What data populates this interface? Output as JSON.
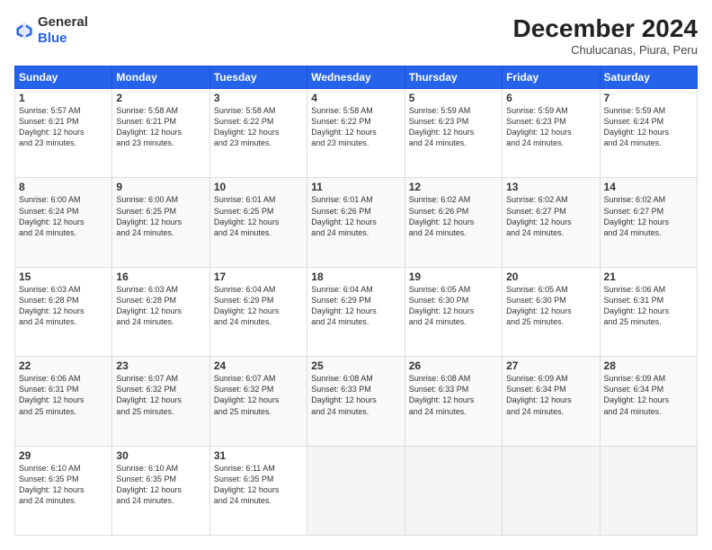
{
  "header": {
    "logo_general": "General",
    "logo_blue": "Blue",
    "month_title": "December 2024",
    "subtitle": "Chulucanas, Piura, Peru"
  },
  "weekdays": [
    "Sunday",
    "Monday",
    "Tuesday",
    "Wednesday",
    "Thursday",
    "Friday",
    "Saturday"
  ],
  "weeks": [
    [
      {
        "day": "1",
        "lines": [
          "Sunrise: 5:57 AM",
          "Sunset: 6:21 PM",
          "Daylight: 12 hours",
          "and 23 minutes."
        ]
      },
      {
        "day": "2",
        "lines": [
          "Sunrise: 5:58 AM",
          "Sunset: 6:21 PM",
          "Daylight: 12 hours",
          "and 23 minutes."
        ]
      },
      {
        "day": "3",
        "lines": [
          "Sunrise: 5:58 AM",
          "Sunset: 6:22 PM",
          "Daylight: 12 hours",
          "and 23 minutes."
        ]
      },
      {
        "day": "4",
        "lines": [
          "Sunrise: 5:58 AM",
          "Sunset: 6:22 PM",
          "Daylight: 12 hours",
          "and 23 minutes."
        ]
      },
      {
        "day": "5",
        "lines": [
          "Sunrise: 5:59 AM",
          "Sunset: 6:23 PM",
          "Daylight: 12 hours",
          "and 24 minutes."
        ]
      },
      {
        "day": "6",
        "lines": [
          "Sunrise: 5:59 AM",
          "Sunset: 6:23 PM",
          "Daylight: 12 hours",
          "and 24 minutes."
        ]
      },
      {
        "day": "7",
        "lines": [
          "Sunrise: 5:59 AM",
          "Sunset: 6:24 PM",
          "Daylight: 12 hours",
          "and 24 minutes."
        ]
      }
    ],
    [
      {
        "day": "8",
        "lines": [
          "Sunrise: 6:00 AM",
          "Sunset: 6:24 PM",
          "Daylight: 12 hours",
          "and 24 minutes."
        ]
      },
      {
        "day": "9",
        "lines": [
          "Sunrise: 6:00 AM",
          "Sunset: 6:25 PM",
          "Daylight: 12 hours",
          "and 24 minutes."
        ]
      },
      {
        "day": "10",
        "lines": [
          "Sunrise: 6:01 AM",
          "Sunset: 6:25 PM",
          "Daylight: 12 hours",
          "and 24 minutes."
        ]
      },
      {
        "day": "11",
        "lines": [
          "Sunrise: 6:01 AM",
          "Sunset: 6:26 PM",
          "Daylight: 12 hours",
          "and 24 minutes."
        ]
      },
      {
        "day": "12",
        "lines": [
          "Sunrise: 6:02 AM",
          "Sunset: 6:26 PM",
          "Daylight: 12 hours",
          "and 24 minutes."
        ]
      },
      {
        "day": "13",
        "lines": [
          "Sunrise: 6:02 AM",
          "Sunset: 6:27 PM",
          "Daylight: 12 hours",
          "and 24 minutes."
        ]
      },
      {
        "day": "14",
        "lines": [
          "Sunrise: 6:02 AM",
          "Sunset: 6:27 PM",
          "Daylight: 12 hours",
          "and 24 minutes."
        ]
      }
    ],
    [
      {
        "day": "15",
        "lines": [
          "Sunrise: 6:03 AM",
          "Sunset: 6:28 PM",
          "Daylight: 12 hours",
          "and 24 minutes."
        ]
      },
      {
        "day": "16",
        "lines": [
          "Sunrise: 6:03 AM",
          "Sunset: 6:28 PM",
          "Daylight: 12 hours",
          "and 24 minutes."
        ]
      },
      {
        "day": "17",
        "lines": [
          "Sunrise: 6:04 AM",
          "Sunset: 6:29 PM",
          "Daylight: 12 hours",
          "and 24 minutes."
        ]
      },
      {
        "day": "18",
        "lines": [
          "Sunrise: 6:04 AM",
          "Sunset: 6:29 PM",
          "Daylight: 12 hours",
          "and 24 minutes."
        ]
      },
      {
        "day": "19",
        "lines": [
          "Sunrise: 6:05 AM",
          "Sunset: 6:30 PM",
          "Daylight: 12 hours",
          "and 24 minutes."
        ]
      },
      {
        "day": "20",
        "lines": [
          "Sunrise: 6:05 AM",
          "Sunset: 6:30 PM",
          "Daylight: 12 hours",
          "and 25 minutes."
        ]
      },
      {
        "day": "21",
        "lines": [
          "Sunrise: 6:06 AM",
          "Sunset: 6:31 PM",
          "Daylight: 12 hours",
          "and 25 minutes."
        ]
      }
    ],
    [
      {
        "day": "22",
        "lines": [
          "Sunrise: 6:06 AM",
          "Sunset: 6:31 PM",
          "Daylight: 12 hours",
          "and 25 minutes."
        ]
      },
      {
        "day": "23",
        "lines": [
          "Sunrise: 6:07 AM",
          "Sunset: 6:32 PM",
          "Daylight: 12 hours",
          "and 25 minutes."
        ]
      },
      {
        "day": "24",
        "lines": [
          "Sunrise: 6:07 AM",
          "Sunset: 6:32 PM",
          "Daylight: 12 hours",
          "and 25 minutes."
        ]
      },
      {
        "day": "25",
        "lines": [
          "Sunrise: 6:08 AM",
          "Sunset: 6:33 PM",
          "Daylight: 12 hours",
          "and 24 minutes."
        ]
      },
      {
        "day": "26",
        "lines": [
          "Sunrise: 6:08 AM",
          "Sunset: 6:33 PM",
          "Daylight: 12 hours",
          "and 24 minutes."
        ]
      },
      {
        "day": "27",
        "lines": [
          "Sunrise: 6:09 AM",
          "Sunset: 6:34 PM",
          "Daylight: 12 hours",
          "and 24 minutes."
        ]
      },
      {
        "day": "28",
        "lines": [
          "Sunrise: 6:09 AM",
          "Sunset: 6:34 PM",
          "Daylight: 12 hours",
          "and 24 minutes."
        ]
      }
    ],
    [
      {
        "day": "29",
        "lines": [
          "Sunrise: 6:10 AM",
          "Sunset: 6:35 PM",
          "Daylight: 12 hours",
          "and 24 minutes."
        ]
      },
      {
        "day": "30",
        "lines": [
          "Sunrise: 6:10 AM",
          "Sunset: 6:35 PM",
          "Daylight: 12 hours",
          "and 24 minutes."
        ]
      },
      {
        "day": "31",
        "lines": [
          "Sunrise: 6:11 AM",
          "Sunset: 6:35 PM",
          "Daylight: 12 hours",
          "and 24 minutes."
        ]
      },
      null,
      null,
      null,
      null
    ]
  ]
}
